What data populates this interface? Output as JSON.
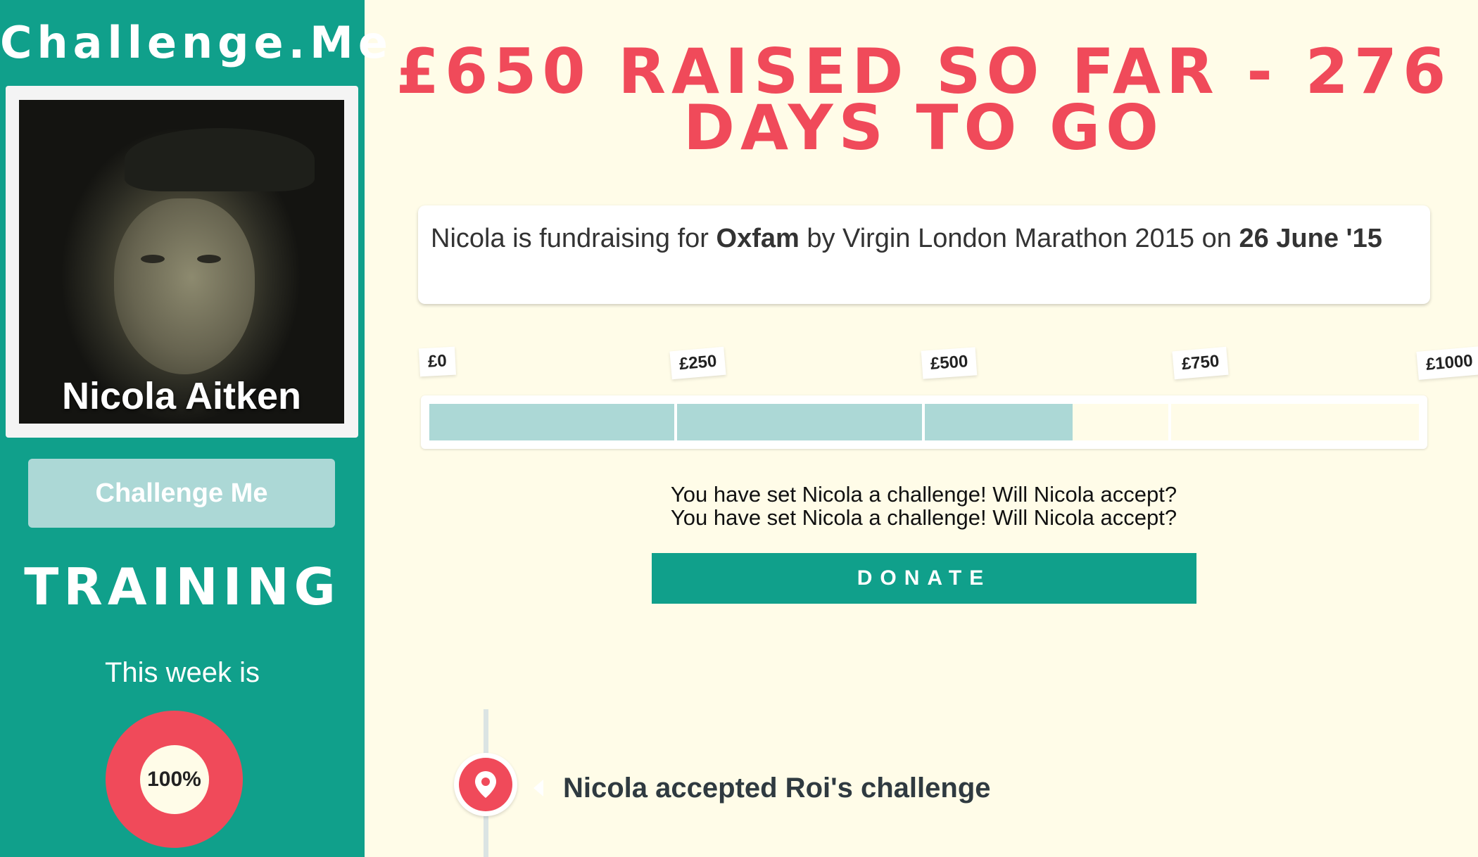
{
  "sidebar": {
    "brand": "Challenge.Me",
    "profile_name": "Nicola Aitken",
    "challenge_button": "Challenge Me",
    "section_title": "TRAINING",
    "week_label": "This week is",
    "week_percent_label": "100%",
    "week_percent": 100
  },
  "main": {
    "headline_line1": "£650 RAISED SO FAR - 276",
    "headline_line2": "DAYS TO GO",
    "info": {
      "prefix": "Nicola is fundraising for ",
      "charity": "Oxfam",
      "middle": " by Virgin London Marathon 2015 on ",
      "date": "26 June '15"
    },
    "progress": {
      "raised": 650,
      "target": 1000,
      "milestones": [
        "£0",
        "£250",
        "£500",
        "£750",
        "£1000"
      ]
    },
    "challenge_message_1": "You have set Nicola a challenge! Will Nicola accept?",
    "challenge_message_2": "You have set Nicola a challenge! Will Nicola accept?",
    "donate_button": "DONATE",
    "timeline": [
      {
        "icon": "location-pin-icon",
        "text": "Nicola accepted Roi's challenge"
      }
    ]
  },
  "colors": {
    "sidebar_green": "#10a08b",
    "accent_red": "#f04a5a",
    "progress_fill": "#acd8d6",
    "background": "#fffce8"
  }
}
